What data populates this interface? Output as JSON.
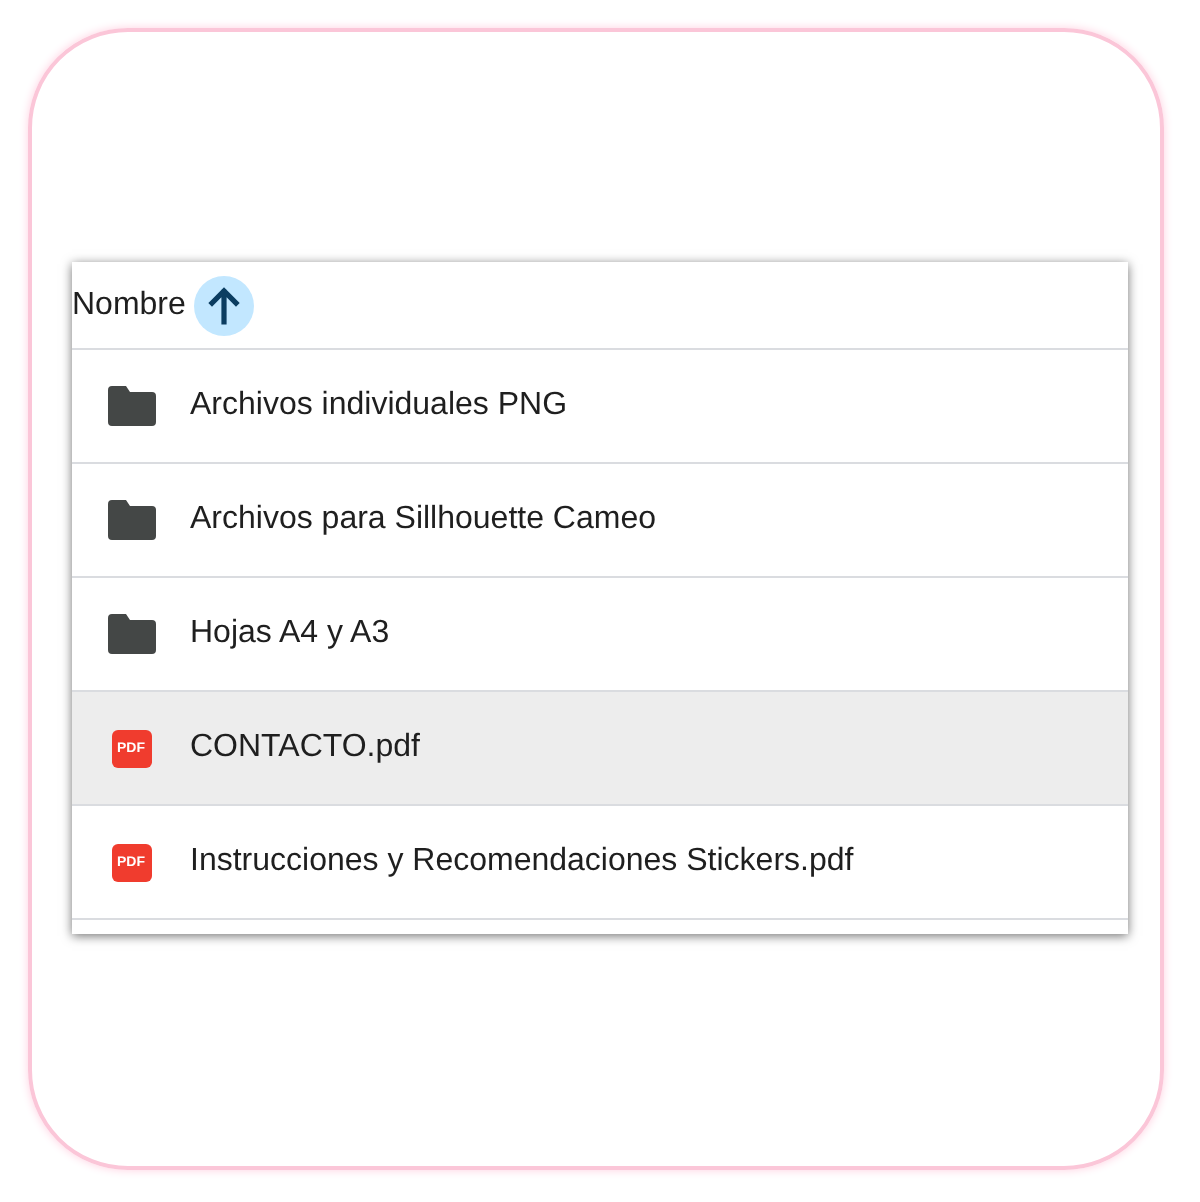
{
  "header": {
    "label": "Nombre",
    "sort_ascending": true
  },
  "rows": [
    {
      "kind": "folder",
      "name": "Archivos individuales PNG",
      "selected": false
    },
    {
      "kind": "folder",
      "name": "Archivos para Sillhouette Cameo",
      "selected": false
    },
    {
      "kind": "folder",
      "name": "Hojas A4 y A3",
      "selected": false
    },
    {
      "kind": "pdf",
      "badge": "PDF",
      "name": "CONTACTO.pdf",
      "selected": true
    },
    {
      "kind": "pdf",
      "badge": "PDF",
      "name": "Instrucciones y Recomendaciones Stickers.pdf",
      "selected": false
    }
  ]
}
